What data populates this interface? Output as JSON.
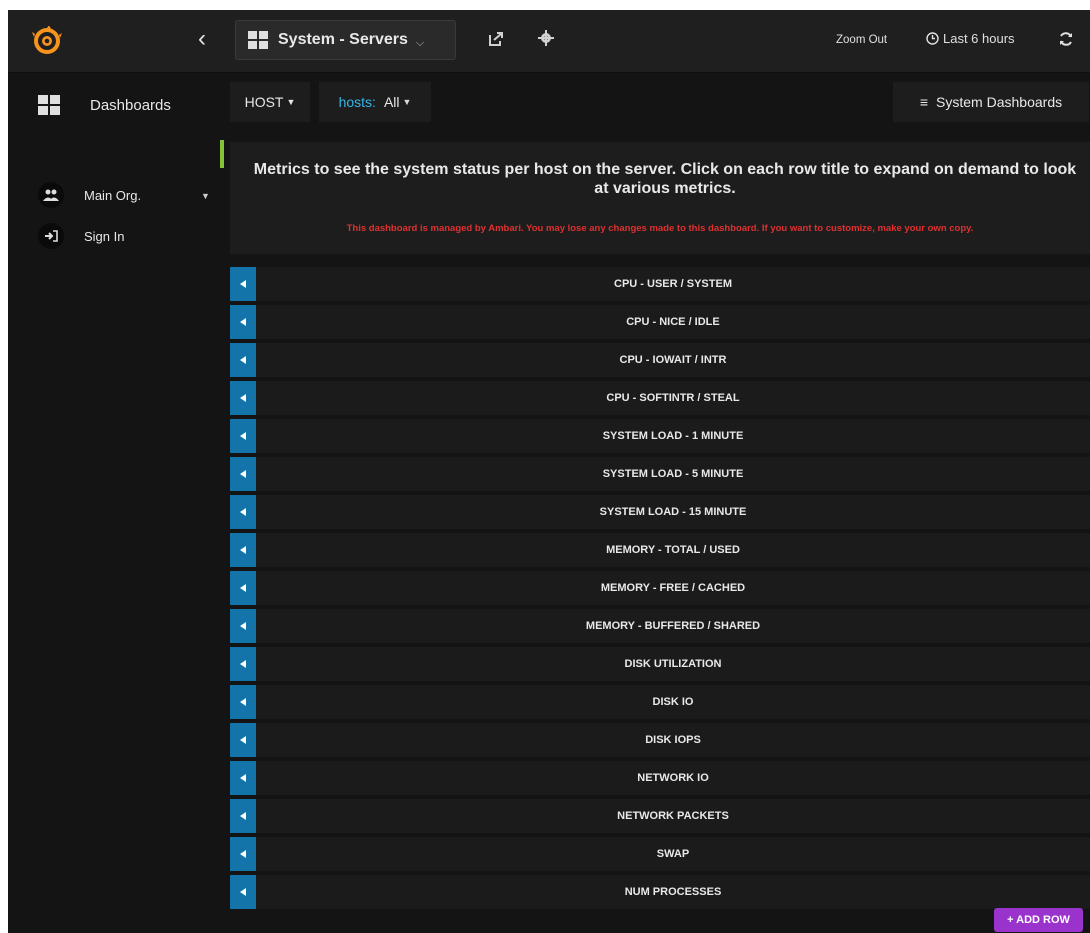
{
  "topbar": {
    "dashboard_title": "System - Servers",
    "zoom_out": "Zoom Out",
    "time_range": "Last 6 hours"
  },
  "sidebar": {
    "dashboards": "Dashboards",
    "org": "Main Org.",
    "sign_in": "Sign In"
  },
  "submenu": {
    "host_label": "HOST",
    "hosts_key": "hosts:",
    "hosts_value": "All",
    "system_dashboards": "System Dashboards"
  },
  "text_panel": {
    "heading": "Metrics to see the system status per host on the server. Click on each row title to expand on demand to look at various metrics.",
    "warning": "This dashboard is managed by Ambari. You may lose any changes made to this dashboard. If you want to customize, make your own copy."
  },
  "rows": [
    "CPU - USER / SYSTEM",
    "CPU - NICE / IDLE",
    "CPU - IOWAIT / INTR",
    "CPU - SOFTINTR / STEAL",
    "SYSTEM LOAD - 1 MINUTE",
    "SYSTEM LOAD - 5 MINUTE",
    "SYSTEM LOAD - 15 MINUTE",
    "MEMORY - TOTAL / USED",
    "MEMORY - FREE / CACHED",
    "MEMORY - BUFFERED / SHARED",
    "DISK UTILIZATION",
    "DISK IO",
    "DISK IOPS",
    "NETWORK IO",
    "NETWORK PACKETS",
    "SWAP",
    "NUM PROCESSES"
  ],
  "add_row": "+ ADD ROW",
  "colors": {
    "background": "#141414",
    "accent_blue": "#1274a8",
    "variable_key": "#33b5e5",
    "warning_red": "#e03030",
    "add_row_purple": "#9933cc",
    "logo_orange": "#f7941d"
  }
}
